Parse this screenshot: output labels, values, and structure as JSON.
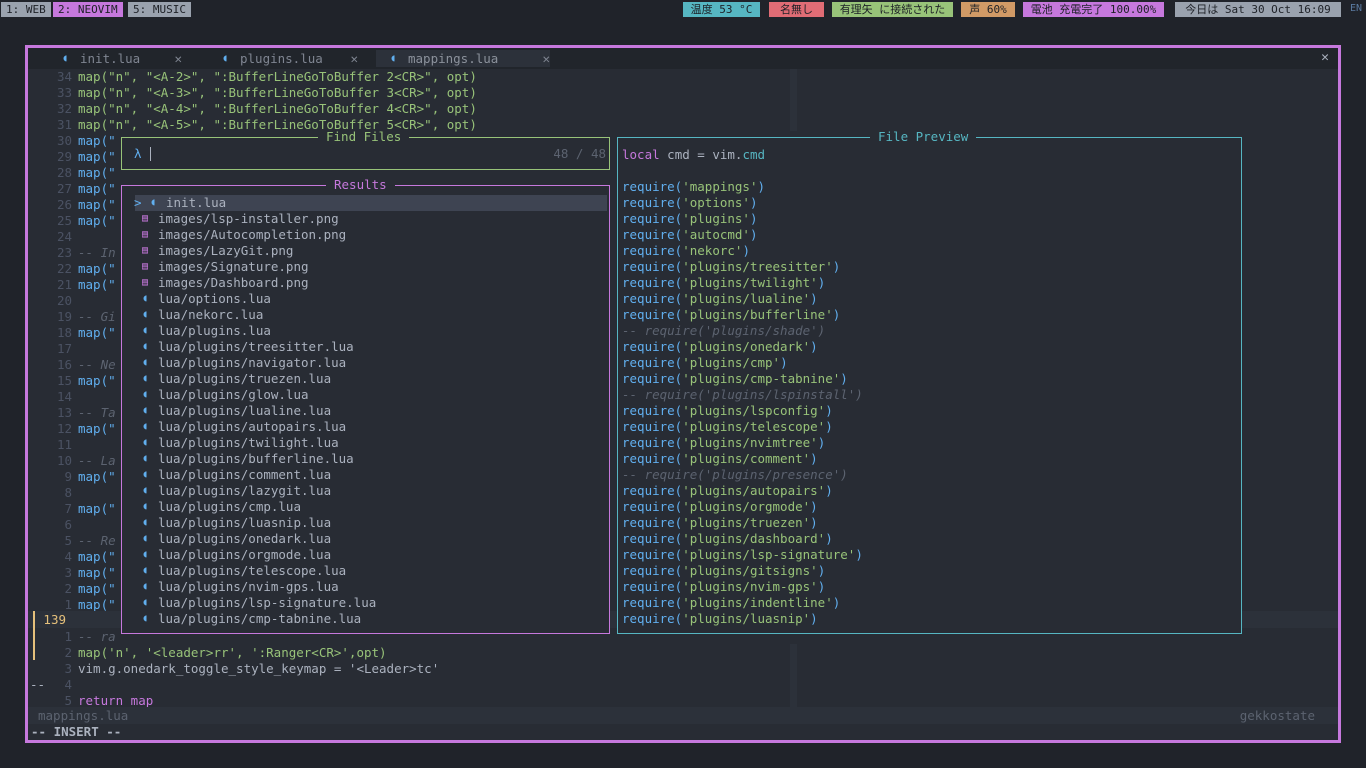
{
  "topbar": {
    "workspaces": [
      "1: WEB",
      "2: NEOVIM",
      "5: MUSIC"
    ],
    "status": [
      "温度 53 °C",
      "名無し",
      "有理矢 に接続された",
      "声 60%",
      "電池 充電完了 100.00%",
      "今日は Sat 30 Oct 16:09"
    ],
    "lang": "EN"
  },
  "tabs": [
    {
      "label": "init.lua",
      "close": "✕"
    },
    {
      "label": "plugins.lua",
      "close": "✕"
    },
    {
      "label": "mappings.lua",
      "close": "✕"
    }
  ],
  "window_close": "✕",
  "code_top": [
    {
      "n": "34",
      "text": "map(\"n\", \"<A-2>\", \":BufferLineGoToBuffer 2<CR>\", opt)"
    },
    {
      "n": "33",
      "text": "map(\"n\", \"<A-3>\", \":BufferLineGoToBuffer 3<CR>\", opt)"
    },
    {
      "n": "32",
      "text": "map(\"n\", \"<A-4>\", \":BufferLineGoToBuffer 4<CR>\", opt)"
    },
    {
      "n": "31",
      "text": "map(\"n\", \"<A-5>\", \":BufferLineGoToBuffer 5<CR>\", opt)"
    }
  ],
  "code_left": [
    {
      "n": "30",
      "text": "map(\"",
      "kind": "map"
    },
    {
      "n": "29",
      "text": "map(\"",
      "kind": "map"
    },
    {
      "n": "28",
      "text": "map(\"",
      "kind": "map"
    },
    {
      "n": "27",
      "text": "map(\"",
      "kind": "map"
    },
    {
      "n": "26",
      "text": "map(\"",
      "kind": "map"
    },
    {
      "n": "25",
      "text": "map(\"",
      "kind": "map"
    },
    {
      "n": "24",
      "text": "",
      "kind": "blank"
    },
    {
      "n": "23",
      "text": "-- In",
      "kind": "cmt"
    },
    {
      "n": "22",
      "text": "map(\"",
      "kind": "map"
    },
    {
      "n": "21",
      "text": "map(\"",
      "kind": "map"
    },
    {
      "n": "20",
      "text": "",
      "kind": "blank"
    },
    {
      "n": "19",
      "text": "-- Gi",
      "kind": "cmt"
    },
    {
      "n": "18",
      "text": "map(\"",
      "kind": "map"
    },
    {
      "n": "17",
      "text": "",
      "kind": "blank"
    },
    {
      "n": "16",
      "text": "-- Ne",
      "kind": "cmt"
    },
    {
      "n": "15",
      "text": "map(\"",
      "kind": "map"
    },
    {
      "n": "14",
      "text": "",
      "kind": "blank"
    },
    {
      "n": "13",
      "text": "-- Ta",
      "kind": "cmt"
    },
    {
      "n": "12",
      "text": "map(\"",
      "kind": "map"
    },
    {
      "n": "11",
      "text": "",
      "kind": "blank"
    },
    {
      "n": "10",
      "text": "-- La",
      "kind": "cmt"
    },
    {
      "n": "9",
      "text": "map(\"",
      "kind": "map"
    },
    {
      "n": "8",
      "text": "",
      "kind": "blank"
    },
    {
      "n": "7",
      "text": "map(\"",
      "kind": "map"
    },
    {
      "n": "6",
      "text": "",
      "kind": "blank"
    },
    {
      "n": "5",
      "text": "-- Re",
      "kind": "cmt"
    },
    {
      "n": "4",
      "text": "map(\"",
      "kind": "map"
    },
    {
      "n": "3",
      "text": "map(\"",
      "kind": "map"
    },
    {
      "n": "2",
      "text": "map(\"",
      "kind": "map"
    },
    {
      "n": "1",
      "text": "map(\"",
      "kind": "map"
    }
  ],
  "current_line": "139",
  "code_bottom": [
    {
      "n": "1",
      "text": "-- ra"
    },
    {
      "n": "2",
      "text": "map('n', '<leader>rr', ':Ranger<CR>',opt)"
    },
    {
      "n": "3",
      "text": "vim.g.onedark_toggle_style_keymap = '<Leader>tc'"
    },
    {
      "n": "4",
      "text": "",
      "prefix": "--"
    },
    {
      "n": "5",
      "text": "return map"
    }
  ],
  "statusline": {
    "file": "mappings.lua",
    "right": "gekkostate"
  },
  "mode": "-- INSERT --",
  "finder": {
    "prompt_title": "Find Files",
    "prompt_symbol": "λ",
    "counter": "48 / 48",
    "results_title": "Results",
    "selected_marker": ">",
    "results": [
      {
        "name": "init.lua",
        "type": "lua"
      },
      {
        "name": "images/lsp-installer.png",
        "type": "img"
      },
      {
        "name": "images/Autocompletion.png",
        "type": "img"
      },
      {
        "name": "images/LazyGit.png",
        "type": "img"
      },
      {
        "name": "images/Signature.png",
        "type": "img"
      },
      {
        "name": "images/Dashboard.png",
        "type": "img"
      },
      {
        "name": "lua/options.lua",
        "type": "lua"
      },
      {
        "name": "lua/nekorc.lua",
        "type": "lua"
      },
      {
        "name": "lua/plugins.lua",
        "type": "lua"
      },
      {
        "name": "lua/plugins/treesitter.lua",
        "type": "lua"
      },
      {
        "name": "lua/plugins/navigator.lua",
        "type": "lua"
      },
      {
        "name": "lua/plugins/truezen.lua",
        "type": "lua"
      },
      {
        "name": "lua/plugins/glow.lua",
        "type": "lua"
      },
      {
        "name": "lua/plugins/lualine.lua",
        "type": "lua"
      },
      {
        "name": "lua/plugins/autopairs.lua",
        "type": "lua"
      },
      {
        "name": "lua/plugins/twilight.lua",
        "type": "lua"
      },
      {
        "name": "lua/plugins/bufferline.lua",
        "type": "lua"
      },
      {
        "name": "lua/plugins/comment.lua",
        "type": "lua"
      },
      {
        "name": "lua/plugins/lazygit.lua",
        "type": "lua"
      },
      {
        "name": "lua/plugins/cmp.lua",
        "type": "lua"
      },
      {
        "name": "lua/plugins/luasnip.lua",
        "type": "lua"
      },
      {
        "name": "lua/plugins/onedark.lua",
        "type": "lua"
      },
      {
        "name": "lua/plugins/orgmode.lua",
        "type": "lua"
      },
      {
        "name": "lua/plugins/telescope.lua",
        "type": "lua"
      },
      {
        "name": "lua/plugins/nvim-gps.lua",
        "type": "lua"
      },
      {
        "name": "lua/plugins/lsp-signature.lua",
        "type": "lua"
      },
      {
        "name": "lua/plugins/cmp-tabnine.lua",
        "type": "lua"
      }
    ],
    "preview_title": "File Preview",
    "preview": [
      {
        "kind": "local",
        "text": "local cmd = vim.cmd"
      },
      {
        "kind": "blank",
        "text": ""
      },
      {
        "kind": "req",
        "text": "'mappings'"
      },
      {
        "kind": "req",
        "text": "'options'"
      },
      {
        "kind": "req",
        "text": "'plugins'"
      },
      {
        "kind": "req",
        "text": "'autocmd'"
      },
      {
        "kind": "req",
        "text": "'nekorc'"
      },
      {
        "kind": "req",
        "text": "'plugins/treesitter'"
      },
      {
        "kind": "req",
        "text": "'plugins/twilight'"
      },
      {
        "kind": "req",
        "text": "'plugins/lualine'"
      },
      {
        "kind": "req",
        "text": "'plugins/bufferline'"
      },
      {
        "kind": "cmt",
        "text": "-- require('plugins/shade')"
      },
      {
        "kind": "req",
        "text": "'plugins/onedark'"
      },
      {
        "kind": "req",
        "text": "'plugins/cmp'"
      },
      {
        "kind": "req",
        "text": "'plugins/cmp-tabnine'"
      },
      {
        "kind": "cmt",
        "text": "-- require('plugins/lspinstall')"
      },
      {
        "kind": "req",
        "text": "'plugins/lspconfig'"
      },
      {
        "kind": "req",
        "text": "'plugins/telescope'"
      },
      {
        "kind": "req",
        "text": "'plugins/nvimtree'"
      },
      {
        "kind": "req",
        "text": "'plugins/comment'"
      },
      {
        "kind": "cmt",
        "text": "-- require('plugins/presence')"
      },
      {
        "kind": "req",
        "text": "'plugins/autopairs'"
      },
      {
        "kind": "req",
        "text": "'plugins/orgmode'"
      },
      {
        "kind": "req",
        "text": "'plugins/truezen'"
      },
      {
        "kind": "req",
        "text": "'plugins/dashboard'"
      },
      {
        "kind": "req",
        "text": "'plugins/lsp-signature'"
      },
      {
        "kind": "req",
        "text": "'plugins/gitsigns'"
      },
      {
        "kind": "req",
        "text": "'plugins/nvim-gps'"
      },
      {
        "kind": "req",
        "text": "'plugins/indentline'"
      },
      {
        "kind": "req",
        "text": "'plugins/luasnip'"
      }
    ]
  },
  "colors": {
    "accent": "#c678dd",
    "green": "#98c379",
    "cyan": "#56b6c2",
    "blue": "#61afef",
    "yellow": "#e5c07b",
    "bg": "#282c34"
  },
  "icons": {
    "lua": "lua-file-icon",
    "img": "image-file-icon"
  }
}
